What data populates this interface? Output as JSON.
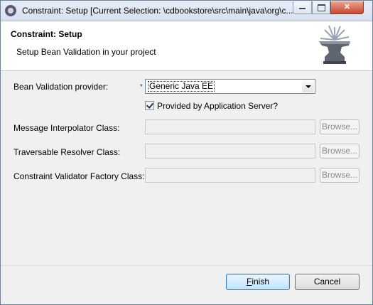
{
  "window": {
    "title": "Constraint: Setup [Current Selection: \\cdbookstore\\src\\main\\java\\org\\c...",
    "close_label": "✕"
  },
  "banner": {
    "title": "Constraint: Setup",
    "description": "Setup Bean Validation in your project",
    "icon": "anvil-icon"
  },
  "form": {
    "provider_label": "Bean Validation provider:",
    "required_marker": "*",
    "provider_value": "Generic Java EE",
    "provided_checkbox_label": "Provided by Application Server?",
    "provided_checked": true,
    "rows": [
      {
        "label": "Message Interpolator Class:",
        "value": "",
        "browse": "Browse..."
      },
      {
        "label": "Traversable Resolver Class:",
        "value": "",
        "browse": "Browse..."
      },
      {
        "label": "Constraint Validator Factory Class:",
        "value": "",
        "browse": "Browse..."
      }
    ]
  },
  "buttons": {
    "finish_first": "F",
    "finish_rest": "inish",
    "cancel": "Cancel"
  }
}
